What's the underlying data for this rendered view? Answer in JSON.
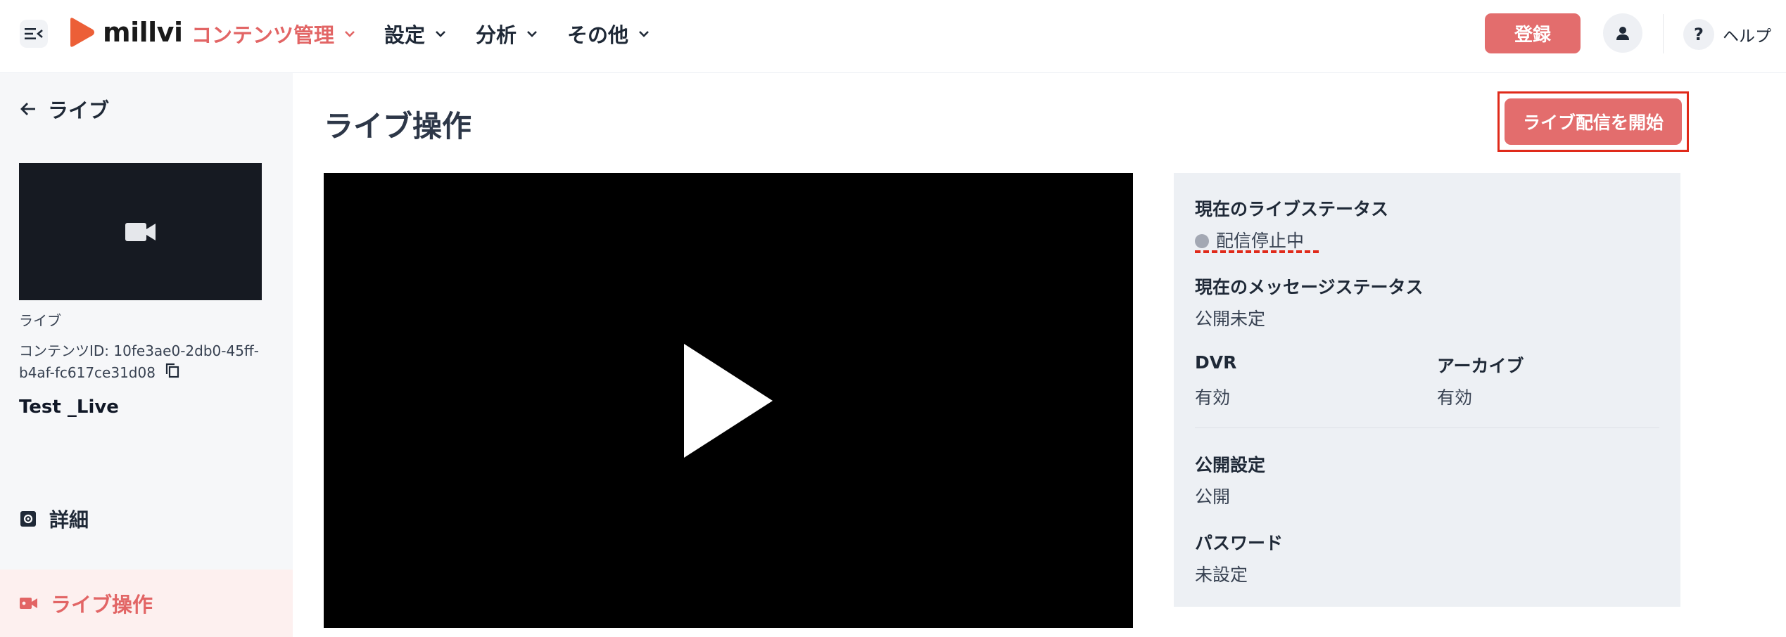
{
  "header": {
    "logo_text": "millvi",
    "nav": [
      {
        "label": "コンテンツ管理",
        "active": true
      },
      {
        "label": "設定",
        "active": false
      },
      {
        "label": "分析",
        "active": false
      },
      {
        "label": "その他",
        "active": false
      }
    ],
    "register_label": "登録",
    "help_label": "ヘルプ",
    "help_icon_glyph": "?"
  },
  "sidebar": {
    "back_label": "ライブ",
    "content_type": "ライブ",
    "content_id": "コンテンツID: 10fe3ae0-2db0-45ff-b4af-fc617ce31d08",
    "content_name": "Test _Live",
    "items": [
      {
        "label": "詳細",
        "icon": "gear-icon",
        "active": false
      },
      {
        "label": "ライブ操作",
        "icon": "video-camera-icon",
        "active": true
      }
    ]
  },
  "main": {
    "title": "ライブ操作",
    "start_button_label": "ライブ配信を開始",
    "status_panel": {
      "live_status_label": "現在のライブステータス",
      "live_status_value": "配信停止中",
      "message_status_label": "現在のメッセージステータス",
      "message_status_value": "公開未定",
      "dvr_label": "DVR",
      "dvr_value": "有効",
      "archive_label": "アーカイブ",
      "archive_value": "有効",
      "publish_label": "公開設定",
      "publish_value": "公開",
      "password_label": "パスワード",
      "password_value": "未設定"
    }
  },
  "colors": {
    "accent": "#e36d6d",
    "accent_text": "#e26565",
    "annotation_red": "#e02a1a",
    "panel_bg": "#edf0f4",
    "sidebar_bg": "#f6f7f9",
    "status_dot": "#a3a8b3"
  }
}
